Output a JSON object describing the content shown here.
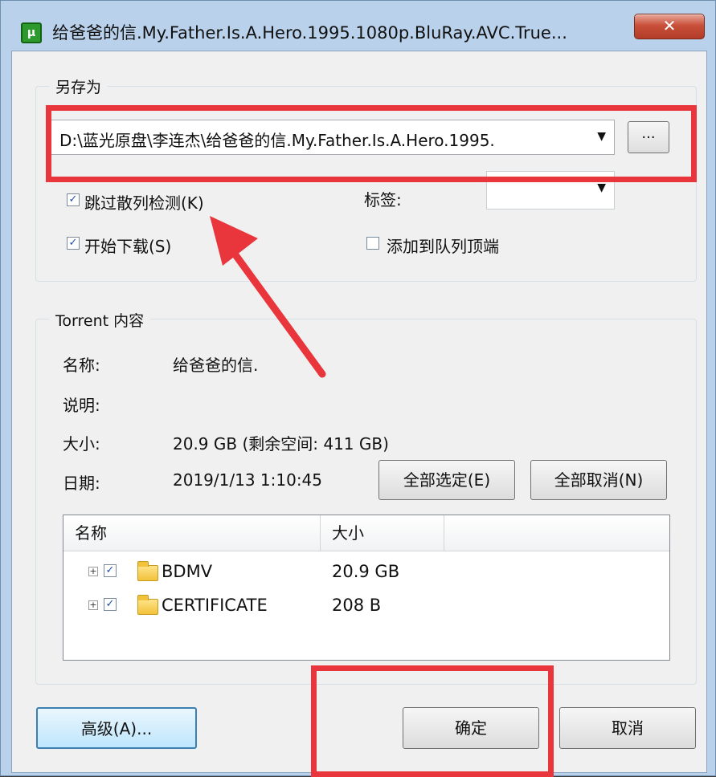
{
  "window": {
    "title": "给爸爸的信.My.Father.Is.A.Hero.1995.1080p.BluRay.AVC.True...",
    "close_glyph": "✕",
    "app_icon_glyph": "μ"
  },
  "save_as": {
    "legend": "另存为",
    "path_value": "D:\\蓝光原盘\\李连杰\\给爸爸的信.My.Father.Is.A.Hero.1995.",
    "browse_label": "...",
    "skip_hash_label": "跳过散列检测(K)",
    "skip_hash_checked": true,
    "start_download_label": "开始下载(S)",
    "start_download_checked": true,
    "tag_label": "标签:",
    "tag_value": "",
    "add_top_label": "添加到队列顶端",
    "add_top_checked": false
  },
  "torrent": {
    "legend": "Torrent 内容",
    "name_label": "名称:",
    "name_value": "给爸爸的信.",
    "comment_label": "说明:",
    "comment_value": "",
    "size_label": "大小:",
    "size_value": "20.9 GB (剩余空间: 411 GB)",
    "date_label": "日期:",
    "date_value": "2019/1/13 1:10:45",
    "select_all_label": "全部选定(E)",
    "deselect_all_label": "全部取消(N)",
    "columns": [
      "名称",
      "大小"
    ],
    "files": [
      {
        "name": "BDMV",
        "size": "20.9 GB",
        "checked": true
      },
      {
        "name": "CERTIFICATE",
        "size": "208 B",
        "checked": true
      }
    ]
  },
  "footer": {
    "advanced_label": "高级(A)...",
    "ok_label": "确定",
    "cancel_label": "取消"
  },
  "colors": {
    "annotation_red": "#e8363c",
    "window_frame": "#b9d1ea",
    "dialog_bg": "#f0f0f0"
  },
  "icons": [
    "app-logo-icon",
    "close-icon",
    "dropdown-arrow-icon",
    "checkbox-checked-icon",
    "checkbox-unchecked-icon",
    "expand-plus-icon",
    "folder-icon",
    "annotation-arrow"
  ]
}
